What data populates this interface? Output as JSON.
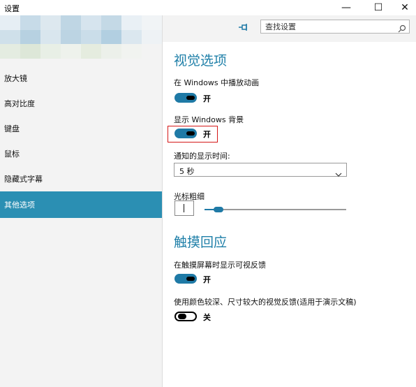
{
  "window": {
    "title": "设置",
    "minimize_glyph": "—",
    "maximize_glyph": "☐",
    "close_glyph": "✕"
  },
  "sidebar": {
    "items": [
      {
        "label": "放大镜",
        "active": false
      },
      {
        "label": "高对比度",
        "active": false
      },
      {
        "label": "键盘",
        "active": false
      },
      {
        "label": "鼠标",
        "active": false
      },
      {
        "label": "隐藏式字幕",
        "active": false
      },
      {
        "label": "其他选项",
        "active": true
      }
    ]
  },
  "header": {
    "pin_icon": "pin-icon",
    "search": {
      "value": "查找设置",
      "icon": "search-icon"
    }
  },
  "visual": {
    "heading": "视觉选项",
    "play_animations": {
      "label": "在 Windows 中播放动画",
      "state": "开",
      "on": true
    },
    "show_background": {
      "label": "显示 Windows 背景",
      "state": "开",
      "on": true
    },
    "notification_time": {
      "label": "通知的显示时间:",
      "value": "5 秒"
    },
    "cursor_thickness": {
      "label": "光标粗细",
      "level": 0.1
    }
  },
  "touch": {
    "heading": "触摸回应",
    "visual_feedback": {
      "label": "在触摸屏幕时显示可视反馈",
      "state": "开",
      "on": true
    },
    "darker_feedback": {
      "label": "使用颜色较深、尺寸较大的视觉反馈(适用于演示文稿)",
      "state": "关",
      "on": false
    }
  },
  "colors": {
    "accent": "#2b8fb3",
    "toggle_on": "#1f7aa6",
    "heading": "#1e7fa8",
    "highlight": "#d51717",
    "sidebar_bg": "#f3f3f3"
  }
}
